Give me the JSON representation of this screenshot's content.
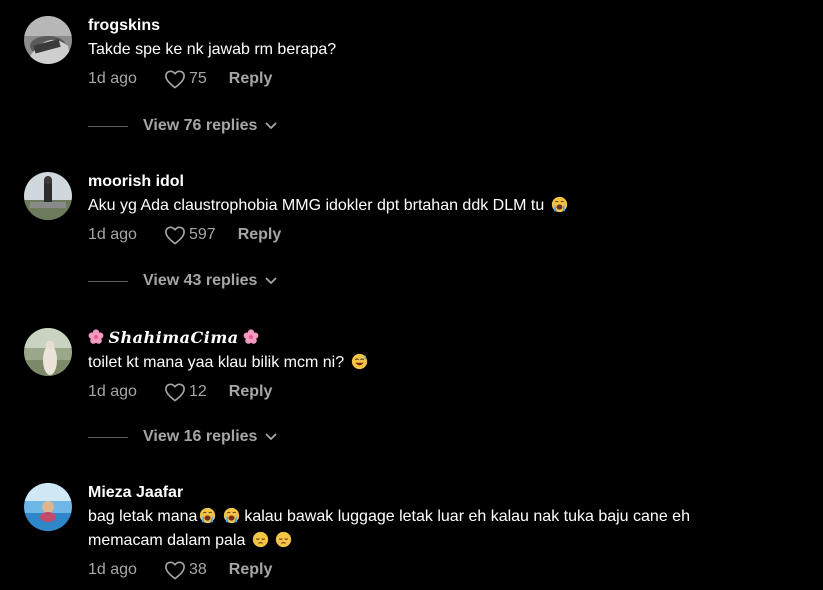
{
  "comments": [
    {
      "username": "frogskins",
      "text": "Takde spe ke nk jawab rm berapa?",
      "time": "1d ago",
      "likes": "75",
      "reply_label": "Reply",
      "replies_label": "View 76 replies"
    },
    {
      "username": "moorish idol",
      "text": "Aku yg Ada claustrophobia MMG idokler dpt brtahan ddk DLM tu",
      "time": "1d ago",
      "likes": "597",
      "reply_label": "Reply",
      "replies_label": "View 43 replies",
      "emoji": "crying-face-icon"
    },
    {
      "username": "𝑺𝒉𝒂𝒉𝒊𝒎𝒂𝑪𝒊𝒎𝒂",
      "text": "toilet kt mana yaa klau bilik mcm ni?",
      "time": "1d ago",
      "likes": "12",
      "reply_label": "Reply",
      "replies_label": "View 16 replies",
      "emoji": "sweat-smile-icon",
      "name_decoration": "cherry-blossom-icon"
    },
    {
      "username": "Mieza Jaafar",
      "text_line1_a": "bag letak mana",
      "text_line1_b": "kalau bawak luggage letak luar eh kalau nak tuka baju cane eh",
      "text_line2": "memacam dalam pala",
      "time": "1d ago",
      "likes": "38",
      "reply_label": "Reply",
      "emojis": [
        "crying-face-icon",
        "pensive-face-icon"
      ]
    }
  ],
  "colors": {
    "background": "#000000",
    "text": "#ffffff",
    "muted": "#a6a6a6"
  }
}
